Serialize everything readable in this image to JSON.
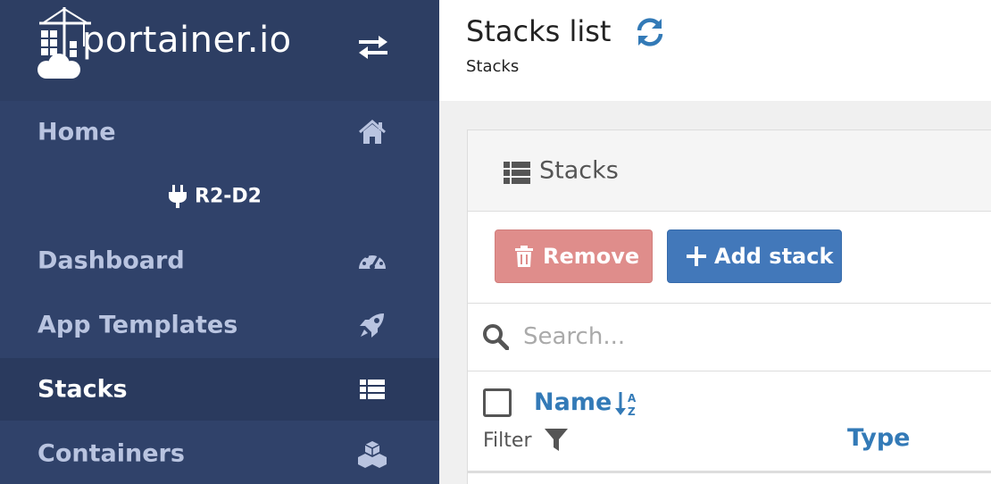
{
  "brand": {
    "logo_text": "portainer.io"
  },
  "sidebar": {
    "items": [
      {
        "label": "Home",
        "icon": "home-icon",
        "active": false
      },
      {
        "label": "Dashboard",
        "icon": "dashboard-gauge-icon",
        "active": false
      },
      {
        "label": "App Templates",
        "icon": "rocket-icon",
        "active": false
      },
      {
        "label": "Stacks",
        "icon": "list-icon",
        "active": true
      },
      {
        "label": "Containers",
        "icon": "cubes-icon",
        "active": false
      }
    ],
    "endpoint": {
      "name": "R2-D2",
      "icon": "plug-icon"
    }
  },
  "header": {
    "title": "Stacks list",
    "breadcrumb": "Stacks"
  },
  "panel": {
    "title": "Stacks",
    "remove_label": "Remove",
    "add_label": "Add stack",
    "search_placeholder": "Search...",
    "columns": {
      "name": "Name",
      "type": "Type",
      "filter": "Filter"
    }
  },
  "colors": {
    "sidebar": "#30426a",
    "accent": "#337ab7",
    "remove": "#df8d8b",
    "add": "#4278ba"
  }
}
